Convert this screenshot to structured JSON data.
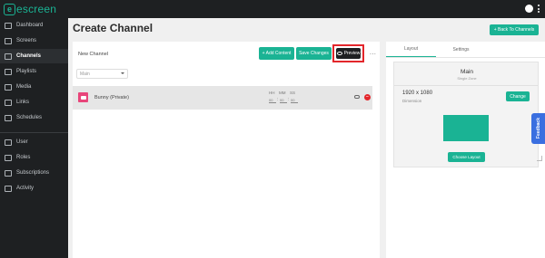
{
  "topbar": {
    "logo_mark": "e",
    "logo_text": "escreen"
  },
  "sidebar": {
    "items": [
      {
        "label": "Dashboard",
        "icon": "home-icon"
      },
      {
        "label": "Screens",
        "icon": "monitor-icon"
      },
      {
        "label": "Channels",
        "icon": "channel-icon",
        "active": true
      },
      {
        "label": "Playlists",
        "icon": "playlist-icon"
      },
      {
        "label": "Media",
        "icon": "media-icon"
      },
      {
        "label": "Links",
        "icon": "link-icon"
      },
      {
        "label": "Schedules",
        "icon": "calendar-icon"
      },
      {
        "label": "User",
        "icon": "users-icon"
      },
      {
        "label": "Roles",
        "icon": "roles-icon"
      },
      {
        "label": "Subscriptions",
        "icon": "subscription-icon"
      },
      {
        "label": "Activity",
        "icon": "activity-icon"
      }
    ]
  },
  "header": {
    "title": "Create Channel",
    "back_label": "+ Back To Channels"
  },
  "editor": {
    "name_value": "New Channel",
    "add_content_label": "+ Add Content",
    "save_changes_label": "Save Changes",
    "preview_label": "Preview",
    "more_label": "...",
    "zone_select": "Main",
    "content_item": {
      "label": "Bunny (Private)",
      "hh_label": "HH",
      "mm_label": "MM",
      "ss_label": "SS",
      "hh_value": "00",
      "mm_value": "00",
      "ss_value": "00",
      "separator": ":"
    }
  },
  "layout_panel": {
    "tabs": [
      "Layout",
      "Settings"
    ],
    "zone_title": "Main",
    "zone_sub": "Single Zone",
    "resolution": "1920 x 1080",
    "dimension_label": "Dimension",
    "change_label": "Change",
    "choose_layout_label": "Choose Layout"
  },
  "feedback_label": "Feedback",
  "colors": {
    "accent": "#1ab394",
    "sidebar_bg": "#1e2022",
    "highlight": "#e3262b",
    "feedback": "#3a6fe0"
  }
}
